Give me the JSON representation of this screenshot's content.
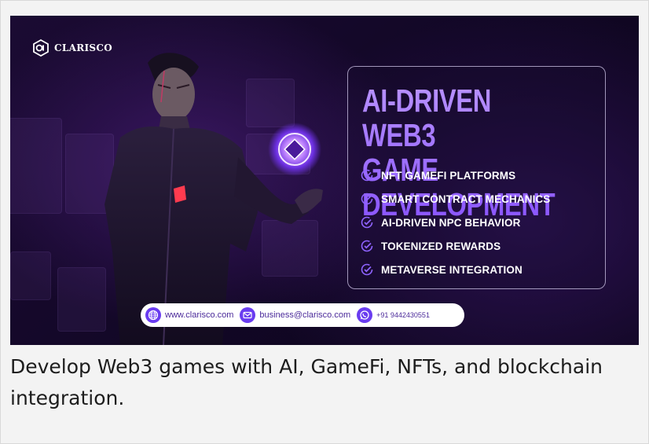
{
  "brand": {
    "name": "CLARISCO"
  },
  "banner": {
    "headline_line1": "AI-DRIVEN WEB3",
    "headline_line2": "GAME DEVELOPMENT",
    "features": [
      "NFT GAMEFI PLATFORMS",
      "SMART CONTRACT MECHANICS",
      "AI-DRIVEN NPC BEHAVIOR",
      "TOKENIZED REWARDS",
      "METAVERSE INTEGRATION"
    ],
    "contact": {
      "website": "www.clarisco.com",
      "email": "business@clarisco.com",
      "phone": "+91 9442430551"
    }
  },
  "caption": "Develop Web3 games with AI, GameFi, NFTs, and blockchain integration.",
  "colors": {
    "accent_purple": "#8a55ff",
    "icon_purple": "#6a3cf0",
    "banner_bg": "#150828"
  },
  "icons": [
    "logo-icon",
    "check-icon",
    "globe-icon",
    "mail-icon",
    "whatsapp-icon",
    "gamefi-orb-icon"
  ]
}
